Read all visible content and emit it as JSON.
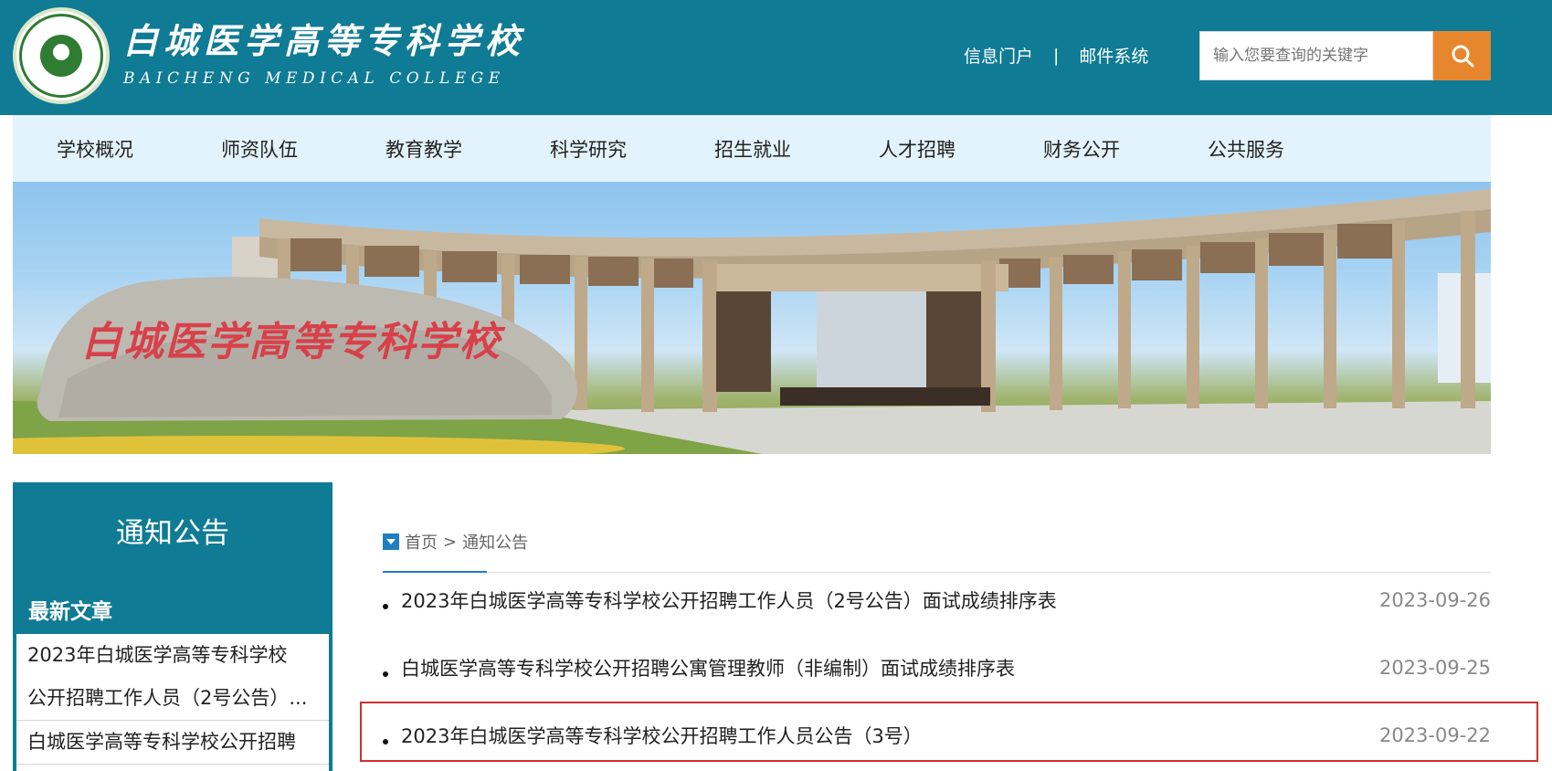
{
  "header": {
    "logo_cn": "白城医学高等专科学校",
    "logo_en": "BAICHENG MEDICAL COLLEGE",
    "links": {
      "info_portal": "信息门户",
      "separator": "|",
      "mail_system": "邮件系统"
    },
    "search": {
      "placeholder": "输入您要查询的关键字",
      "button_icon": "search-icon"
    },
    "colors": {
      "header_bg": "#0f7b94",
      "search_button": "#e8862e"
    }
  },
  "nav": {
    "items": [
      "学校概况",
      "师资队伍",
      "教育教学",
      "科学研究",
      "招生就业",
      "人才招聘",
      "财务公开",
      "公共服务"
    ]
  },
  "banner": {
    "inscription": "白城医学高等专科学校"
  },
  "sidebar": {
    "title": "通知公告",
    "subtitle": "最新文章",
    "items": [
      {
        "line1": "2023年白城医学高等专科学校",
        "line2": "公开招聘工作人员（2号公告）..."
      },
      {
        "line1": "白城医学高等专科学校公开招聘"
      }
    ]
  },
  "breadcrumb": {
    "icon": "dropdown-icon",
    "home": "首页",
    "separator": ">",
    "current": "通知公告"
  },
  "notices": [
    {
      "title": "2023年白城医学高等专科学校公开招聘工作人员（2号公告）面试成绩排序表",
      "date": "2023-09-26"
    },
    {
      "title": "白城医学高等专科学校公开招聘公寓管理教师（非编制）面试成绩排序表",
      "date": "2023-09-25"
    },
    {
      "title": "2023年白城医学高等专科学校公开招聘工作人员公告（3号）",
      "date": "2023-09-22"
    }
  ],
  "highlight_color": "#d32f2f"
}
